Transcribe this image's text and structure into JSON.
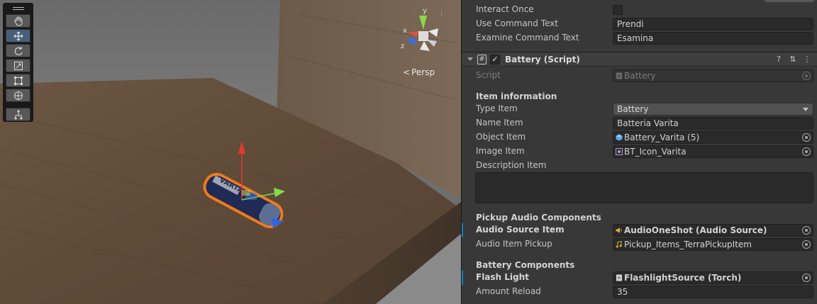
{
  "scene": {
    "view_mode_label": "Persp",
    "gizmo_y_label": "y",
    "gizmo_x_label": "x",
    "gizmo_z_label": "z",
    "tools": [
      {
        "name": "hand-tool",
        "icon": "hand-icon"
      },
      {
        "name": "move-tool",
        "icon": "move-arrows-icon",
        "active": true
      },
      {
        "name": "rotate-tool",
        "icon": "rotate-icon"
      },
      {
        "name": "scale-tool",
        "icon": "scale-icon"
      },
      {
        "name": "rect-tool",
        "icon": "rect-transform-icon"
      },
      {
        "name": "transform-tool",
        "icon": "transform-icon"
      },
      {
        "name": "custom-tool",
        "icon": "custom-editor-tool-icon"
      }
    ],
    "battery_label": "VARTA"
  },
  "inspector": {
    "interact_once": {
      "label": "Interact Once",
      "value": false
    },
    "use_command_text": {
      "label": "Use Command Text",
      "value": "Prendi"
    },
    "examine_command_text": {
      "label": "Examine Command Text",
      "value": "Esamina"
    },
    "component": {
      "title": "Battery (Script)",
      "enabled": true,
      "help_icon": "help-icon",
      "settings_icon": "presets-icon",
      "menu_icon": "kebab-menu-icon"
    },
    "script": {
      "label": "Script",
      "value": "Battery"
    },
    "item_information_header": "Item information",
    "type_item": {
      "label": "Type Item",
      "value": "Battery"
    },
    "name_item": {
      "label": "Name Item",
      "value": "Batteria Varita"
    },
    "object_item": {
      "label": "Object Item",
      "value": "Battery_Varita (5)"
    },
    "image_item": {
      "label": "Image Item",
      "value": "BT_Icon_Varita"
    },
    "description_item": {
      "label": "Description Item",
      "value": ""
    },
    "pickup_audio_header": "Pickup Audio Components",
    "audio_source_item": {
      "label": "Audio Source Item",
      "value": "AudioOneShot (Audio Source)"
    },
    "audio_item_pickup": {
      "label": "Audio Item Pickup",
      "value": "Pickup_Items_TerraPickupItem"
    },
    "battery_components_header": "Battery Components",
    "flash_light": {
      "label": "Flash Light",
      "value": "FlashlightSource (Torch)"
    },
    "amount_reload": {
      "label": "Amount Reload",
      "value": "35"
    }
  }
}
